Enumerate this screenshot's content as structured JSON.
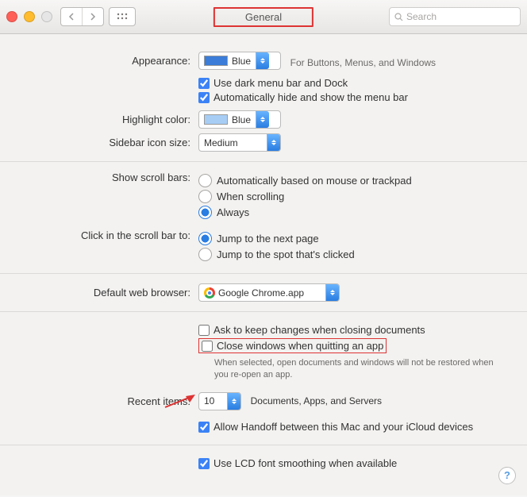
{
  "toolbar": {
    "title": "General",
    "search_placeholder": "Search"
  },
  "appearance": {
    "label": "Appearance:",
    "value": "Blue",
    "note": "For Buttons, Menus, and Windows",
    "dark_menu": "Use dark menu bar and Dock",
    "auto_hide": "Automatically hide and show the menu bar"
  },
  "highlight": {
    "label": "Highlight color:",
    "value": "Blue"
  },
  "sidebar": {
    "label": "Sidebar icon size:",
    "value": "Medium"
  },
  "scrollbars": {
    "label": "Show scroll bars:",
    "opts": [
      "Automatically based on mouse or trackpad",
      "When scrolling",
      "Always"
    ],
    "selected": 2
  },
  "clickscroll": {
    "label": "Click in the scroll bar to:",
    "opts": [
      "Jump to the next page",
      "Jump to the spot that's clicked"
    ],
    "selected": 0
  },
  "browser": {
    "label": "Default web browser:",
    "value": "Google Chrome.app"
  },
  "closing": {
    "ask": "Ask to keep changes when closing documents",
    "close": "Close windows when quitting an app",
    "hint": "When selected, open documents and windows will not be restored when you re-open an app."
  },
  "recent": {
    "label": "Recent items:",
    "value": "10",
    "note": "Documents, Apps, and Servers"
  },
  "handoff": "Allow Handoff between this Mac and your iCloud devices",
  "lcd": "Use LCD font smoothing when available"
}
